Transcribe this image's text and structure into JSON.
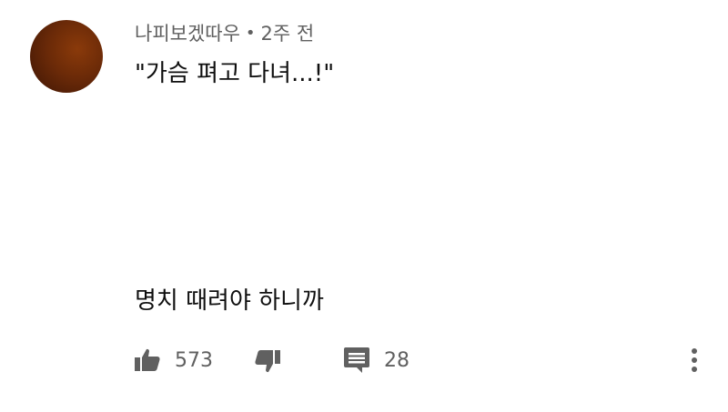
{
  "comment": {
    "author": "나피보겠따우",
    "separator": "•",
    "time": "2주 전",
    "text_line1": "\"가슴 펴고 다녀...!\"",
    "text_line2": "명치 때려야 하니까"
  },
  "actions": {
    "likes": "573",
    "replies": "28",
    "like_icon": "thumbs-up-icon",
    "dislike_icon": "thumbs-down-icon",
    "reply_icon": "comment-icon",
    "more_icon": "more-vertical-icon"
  },
  "colors": {
    "avatar": "#6b2a08",
    "meta_text": "#606060",
    "icon": "#606060",
    "text": "#0f0f0f"
  }
}
